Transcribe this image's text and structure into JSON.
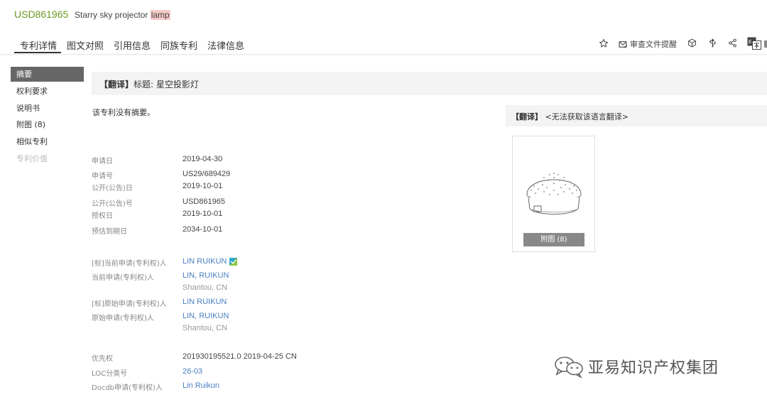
{
  "header": {
    "patent_number": "USD861965",
    "title_prefix": "Starry sky projector ",
    "title_highlight": "lamp"
  },
  "tabs": [
    "专利详情",
    "图文对照",
    "引用信息",
    "同族专利",
    "法律信息"
  ],
  "toolbar": {
    "review_reminder": "审查文件提醒"
  },
  "sidebar": [
    {
      "label": "摘要",
      "state": "active"
    },
    {
      "label": "权利要求",
      "state": "normal"
    },
    {
      "label": "说明书",
      "state": "normal"
    },
    {
      "label": "附图 (8)",
      "state": "normal"
    },
    {
      "label": "相似专利",
      "state": "normal"
    },
    {
      "label": "专利价值",
      "state": "disabled"
    }
  ],
  "translation_bar": {
    "tag": "【翻译】",
    "label": "标题:",
    "text": "星空投影灯"
  },
  "abstract": {
    "text": "该专利没有摘要。"
  },
  "details": {
    "application_date": {
      "label": "申请日",
      "value": "2019-04-30"
    },
    "application_number": {
      "label": "申请号",
      "value": "US29/689429"
    },
    "publication_date": {
      "label": "公开(公告)日",
      "value": "2019-10-01"
    },
    "publication_number": {
      "label": "公开(公告)号",
      "value": "USD861965"
    },
    "grant_date": {
      "label": "授权日",
      "value": "2019-10-01"
    },
    "expiry_date": {
      "label": "预估到期日",
      "value": "2034-10-01"
    },
    "std_current_applicant": {
      "label": "[标]当前申请(专利权)人",
      "value": "LIN RUIKUN"
    },
    "current_applicant": {
      "label": "当前申请(专利权)人",
      "value": "LIN, RUIKUN",
      "location": "Shantou, CN"
    },
    "std_original_applicant": {
      "label": "[标]原始申请(专利权)人",
      "value": "LIN RUIKUN"
    },
    "original_applicant": {
      "label": "原始申请(专利权)人",
      "value": "LIN, RUIKUN",
      "location": "Shantou, CN"
    },
    "priority": {
      "label": "优先权",
      "value": "201930195521.0 2019-04-25 CN"
    },
    "loc_class": {
      "label": "LOC分类号",
      "value": "26-03"
    },
    "docdb_applicant": {
      "label": "Docdb申请(专利权)人",
      "value": "Lin Ruikun"
    }
  },
  "right_panel": {
    "translation_tag": "【翻译】",
    "translation_text": "<无法获取该语言翻译>",
    "figure_button": "附图 (8)"
  },
  "watermark": {
    "text": "亚易知识产权集团"
  }
}
